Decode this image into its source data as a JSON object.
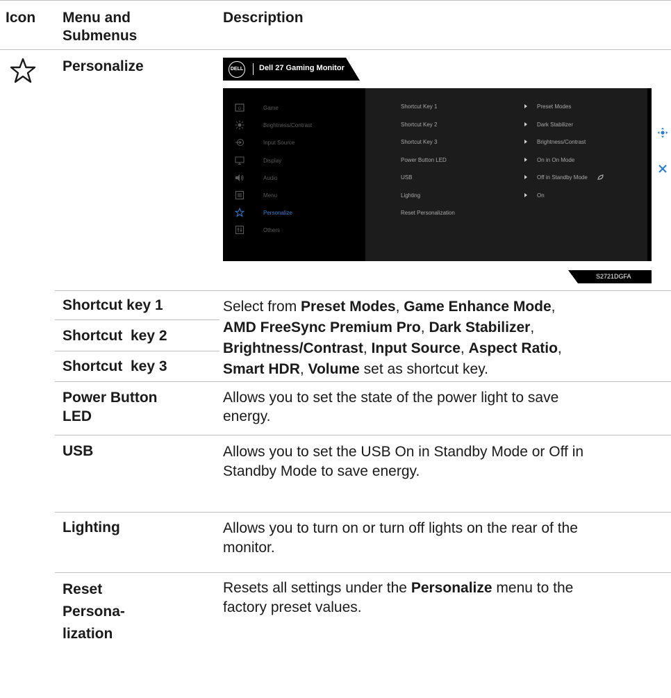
{
  "headers": {
    "icon": "Icon",
    "menu": "Menu and Submenus",
    "description": "Description"
  },
  "menu_title": "Personalize",
  "icon": "star-icon",
  "osd": {
    "brand": "DELL",
    "title": "Dell 27 Gaming Monitor",
    "menu": [
      "Game",
      "Brightness/Contrast",
      "Input Source",
      "Display",
      "Audio",
      "Menu",
      "Personalize",
      "Others"
    ],
    "menu_active": "Personalize",
    "submenu": [
      {
        "label": "Shortcut Key 1",
        "value": "Preset Modes"
      },
      {
        "label": "Shortcut Key 2",
        "value": "Dark Stabilizer"
      },
      {
        "label": "Shortcut Key 3",
        "value": "Brightness/Contrast"
      },
      {
        "label": "Power Button LED",
        "value": "On in On Mode"
      },
      {
        "label": "USB",
        "value": "Off in Standby Mode"
      },
      {
        "label": "Lighting",
        "value": "On"
      },
      {
        "label": "Reset Personalization",
        "value": ""
      }
    ],
    "model": "S2721DGFA",
    "colors": {
      "active": "#2a7fd4",
      "panel": "#000000",
      "subpanel": "#1c1c1c"
    }
  },
  "items": {
    "shortcut1": "Shortcut key 1",
    "shortcut2": "Shortcut  key 2",
    "shortcut3": "Shortcut  key 3",
    "power_led_1": "Power Button",
    "power_led_2": "LED",
    "usb": "USB",
    "lighting": "Lighting",
    "reset_1": "Reset",
    "reset_2": "Persona-",
    "reset_3": "lization"
  },
  "desc": {
    "shortcut": {
      "p1": "Select from ",
      "b1": "Preset Modes",
      "p2": ", ",
      "b2": "Game Enhance Mode",
      "p3": ",",
      "b3": "AMD FreeSync Premium Pro",
      "p4": ", ",
      "b4": "Dark Stabilizer",
      "p5": ",",
      "b5": "Brightness/Contrast",
      "p6": ", ",
      "b6": "Input Source",
      "p7": ", ",
      "b7": "Aspect Ratio",
      "p8": ",",
      "b8": "Smart HDR",
      "p9": ", ",
      "b9": "Volume",
      "p10": " set as shortcut key."
    },
    "power_led_1": "Allows you to set the state of the power light to save",
    "power_led_2": "energy.",
    "usb_1": "Allows you to set the USB On in Standby Mode or Off in",
    "usb_2": "Standby Mode to save energy.",
    "lighting_1": "Allows you to turn on or turn off lights on the rear of the",
    "lighting_2": "monitor.",
    "reset": {
      "p1": "Resets all settings under the ",
      "b1": "Personalize",
      "p2": " menu to the",
      "line2": "factory preset values."
    }
  }
}
